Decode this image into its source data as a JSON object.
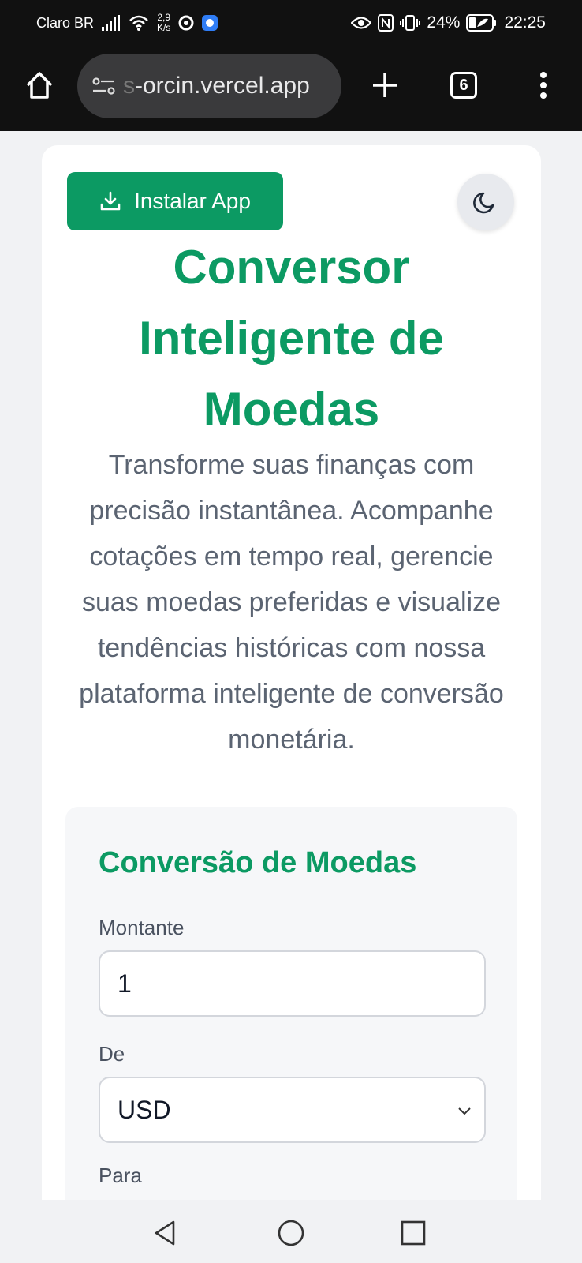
{
  "status_bar": {
    "carrier": "Claro BR",
    "net_speed_value": "2,9",
    "net_speed_unit": "K/s",
    "battery_percent": "24%",
    "time": "22:25"
  },
  "browser": {
    "url_faded": "s",
    "url_text": "-orcin.vercel.app",
    "tab_count": "6"
  },
  "page": {
    "install_button": "Instalar App",
    "title_lines": [
      "Conversor",
      "Inteligente de",
      "Moedas"
    ],
    "description": "Transforme suas finanças com precisão instantânea. Acompanhe cotações em tempo real, gerencie suas moedas preferidas e visualize tendências históricas com nossa plataforma inteligente de conversão monetária.",
    "converter": {
      "title": "Conversão de Moedas",
      "amount_label": "Montante",
      "amount_value": "1",
      "from_label": "De",
      "from_value": "USD",
      "to_label": "Para"
    }
  },
  "colors": {
    "brand_green": "#0c9a63",
    "text_gray": "#5b6472"
  }
}
